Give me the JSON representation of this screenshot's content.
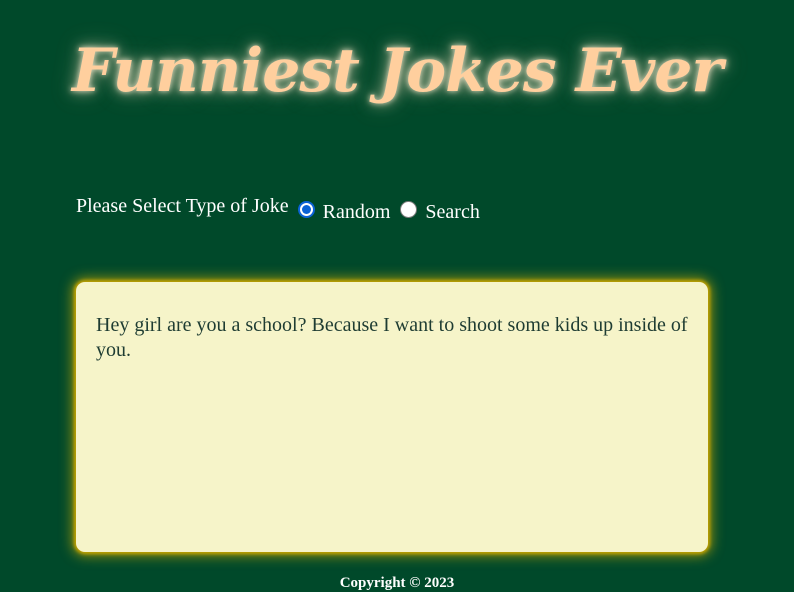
{
  "header": {
    "title": "Funniest Jokes Ever"
  },
  "joke_type": {
    "prompt": "Please Select Type of Joke",
    "options": [
      {
        "label": "Random",
        "selected": true
      },
      {
        "label": "Search",
        "selected": false
      }
    ]
  },
  "joke": {
    "text": "Hey girl are you a school? Because I want to shoot some kids up inside of you."
  },
  "footer": {
    "copyright": "Copyright © 2023"
  },
  "colors": {
    "background": "#00492a",
    "title": "#ffcf9e",
    "joke_box_background": "#f6f4c9",
    "joke_box_glow": "#c2a200",
    "radio_accent": "#0b62d6"
  }
}
